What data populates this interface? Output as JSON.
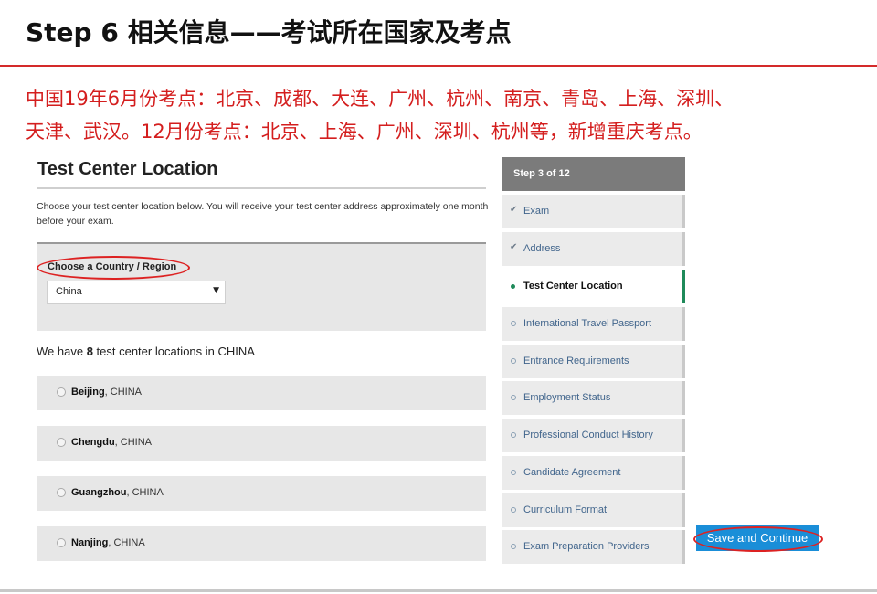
{
  "slide": {
    "title": "Step 6 相关信息——考试所在国家及考点",
    "note_line1": "中国19年6月份考点：北京、成都、大连、广州、杭州、南京、青岛、上海、深圳、",
    "note_line2": "天津、武汉。12月份考点：北京、上海、广州、深圳、杭州等，新增重庆考点。"
  },
  "form": {
    "title": "Test Center Location",
    "description": "Choose your test center location below. You will receive your test center address approximately one month before your exam.",
    "country_label": "Choose a Country / Region",
    "country_value": "China",
    "summary_prefix": "We have ",
    "summary_count": "8",
    "summary_suffix": " test center locations in CHINA",
    "locations": [
      {
        "city": "Beijing",
        "country": ", CHINA"
      },
      {
        "city": "Chengdu",
        "country": ", CHINA"
      },
      {
        "city": "Guangzhou",
        "country": ", CHINA"
      },
      {
        "city": "Nanjing",
        "country": ", CHINA"
      }
    ]
  },
  "steps": {
    "header": "Step 3 of 12",
    "items": [
      {
        "label": "Exam",
        "state": "done"
      },
      {
        "label": "Address",
        "state": "done"
      },
      {
        "label": "Test Center Location",
        "state": "active"
      },
      {
        "label": "International Travel Passport",
        "state": "todo"
      },
      {
        "label": "Entrance Requirements",
        "state": "todo"
      },
      {
        "label": "Employment Status",
        "state": "todo"
      },
      {
        "label": "Professional Conduct History",
        "state": "todo"
      },
      {
        "label": "Candidate Agreement",
        "state": "todo"
      },
      {
        "label": "Curriculum Format",
        "state": "todo"
      },
      {
        "label": "Exam Preparation Providers",
        "state": "todo"
      }
    ]
  },
  "actions": {
    "save_label": "Save and Continue"
  },
  "colors": {
    "accent_red": "#d42a2a",
    "active_green": "#1f8a5a",
    "button_blue": "#1a8ed8"
  }
}
